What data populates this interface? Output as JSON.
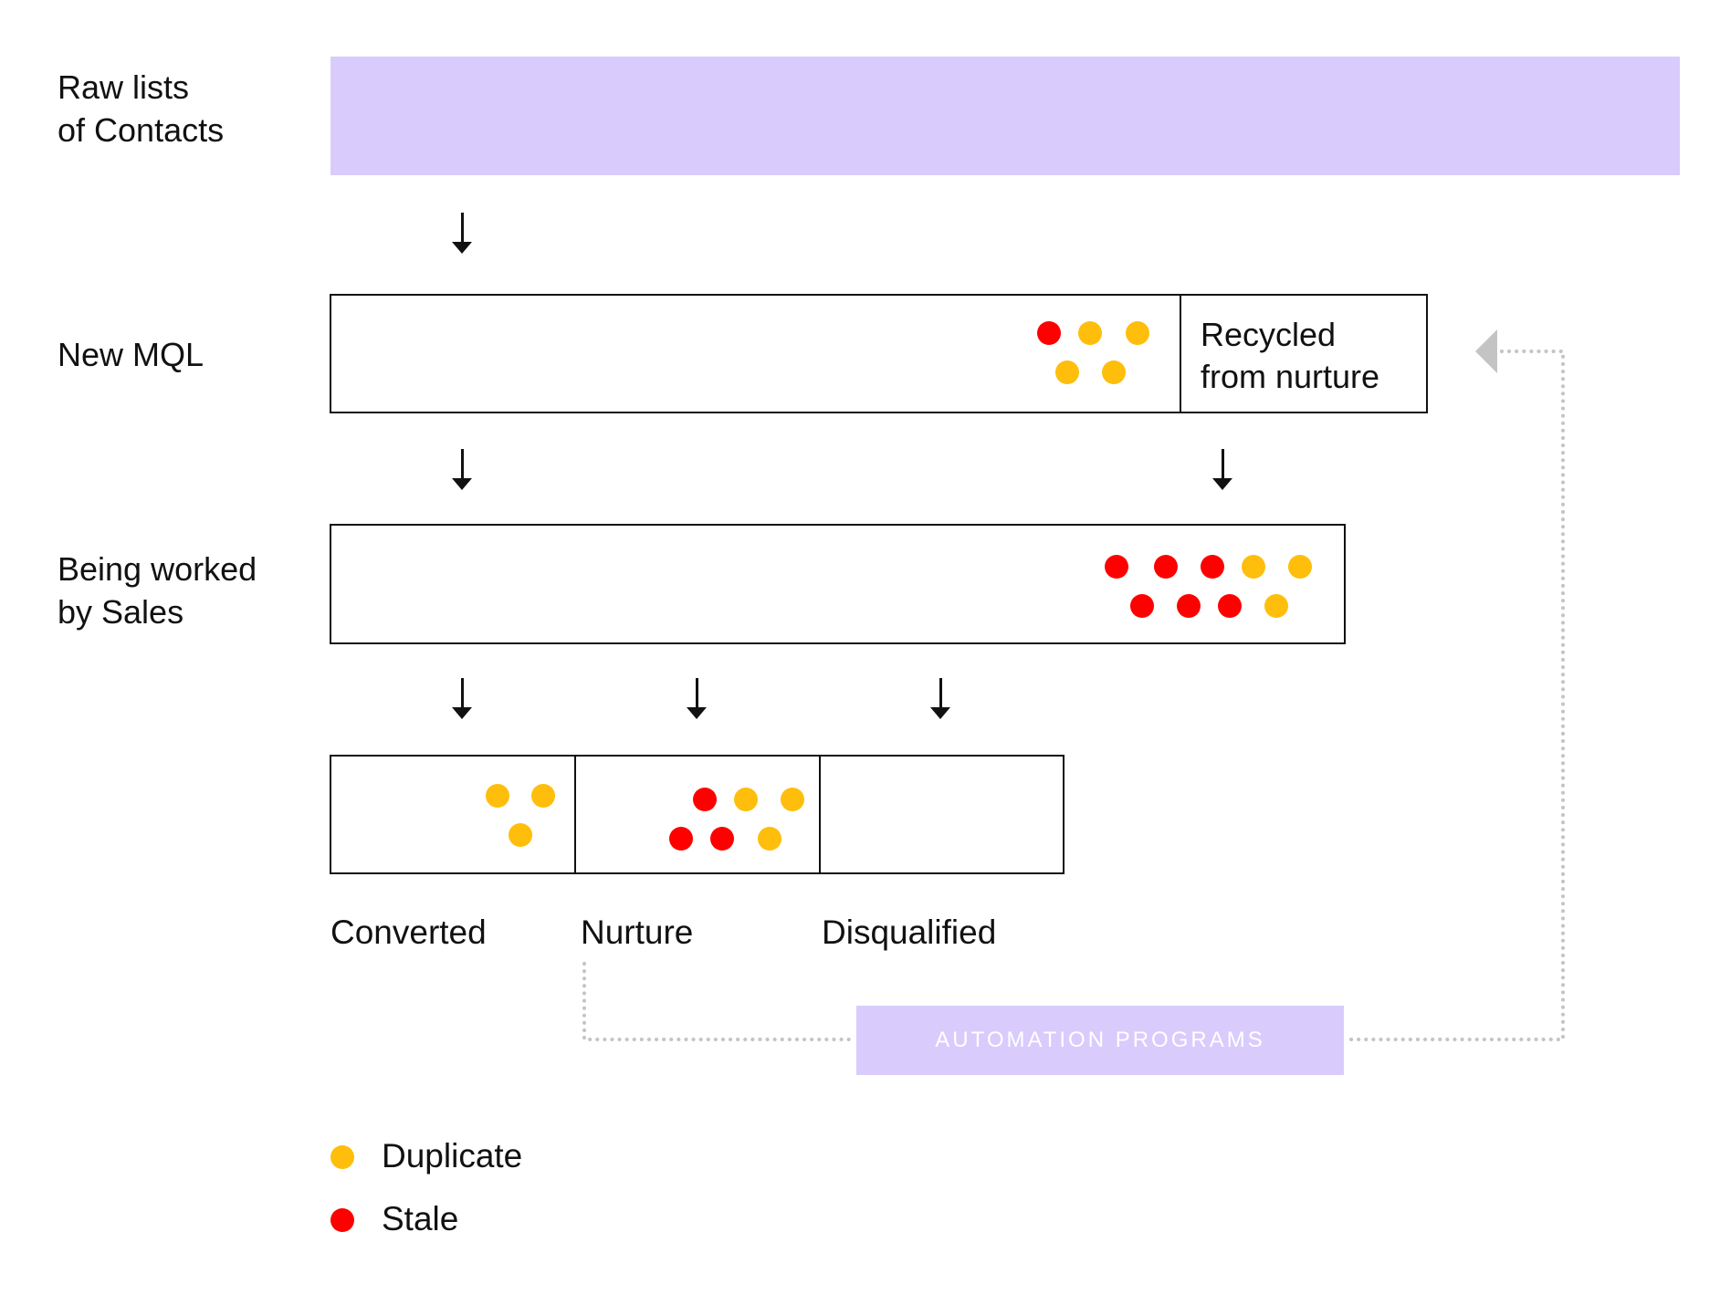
{
  "stages": {
    "raw": {
      "label_line1": "Raw lists",
      "label_line2": "of Contacts"
    },
    "mql": {
      "label": "New MQL",
      "recycled_line1": "Recycled",
      "recycled_line2": "from nurture"
    },
    "sales": {
      "label_line1": "Being worked",
      "label_line2": "by Sales"
    }
  },
  "outcomes": {
    "converted": "Converted",
    "nurture": "Nurture",
    "disqualified": "Disqualified"
  },
  "automation": {
    "label": "AUTOMATION PROGRAMS"
  },
  "legend": {
    "duplicate": "Duplicate",
    "stale": "Stale"
  },
  "colors": {
    "duplicate": "#FFBE0B",
    "stale": "#FF0000",
    "lavender": "#D9CCFC",
    "dotted_line": "#C4C4C4"
  },
  "dot_groups": {
    "mql": {
      "stale": 1,
      "duplicate": 4
    },
    "sales": {
      "stale": 6,
      "duplicate": 3
    },
    "converted": {
      "stale": 0,
      "duplicate": 3
    },
    "nurture": {
      "stale": 3,
      "duplicate": 3
    },
    "disqualified": {
      "stale": 0,
      "duplicate": 0
    }
  }
}
